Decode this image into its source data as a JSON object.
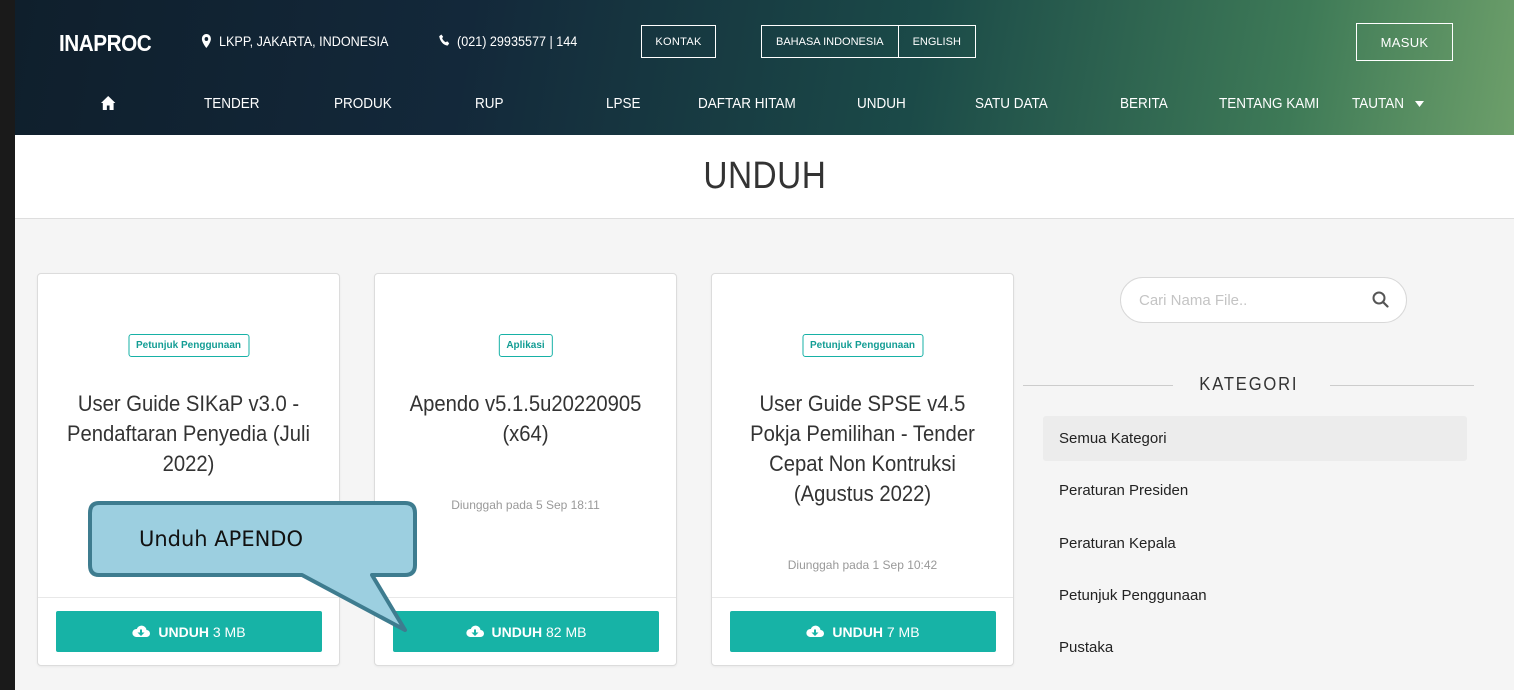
{
  "header": {
    "logo": "INAPROC",
    "location": "LKPP, JAKARTA, INDONESIA",
    "phone": "(021) 29935577 | 144",
    "contact_label": "KONTAK",
    "lang_id": "BAHASA INDONESIA",
    "lang_en": "ENGLISH",
    "login_label": "MASUK",
    "icons": {
      "location": "map-marker-icon",
      "phone": "phone-icon"
    }
  },
  "nav": {
    "home_icon": "home-icon",
    "items": [
      "TENDER",
      "PRODUK",
      "RUP",
      "LPSE",
      "DAFTAR HITAM",
      "UNDUH",
      "SATU DATA",
      "BERITA",
      "TENTANG KAMI",
      "TAUTAN"
    ]
  },
  "page_title": "UNDUH",
  "cards": [
    {
      "badge": "Petunjuk Penggunaan",
      "title": "User Guide SIKaP v3.0 - Pendaftaran Penyedia (Juli 2022)",
      "date": "",
      "button_action": "UNDUH",
      "button_size": "3 MB"
    },
    {
      "badge": "Aplikasi",
      "title": "Apendo v5.1.5u20220905 (x64)",
      "date": "Diunggah pada 5 Sep 18:11",
      "button_action": "UNDUH",
      "button_size": "82 MB"
    },
    {
      "badge": "Petunjuk Penggunaan",
      "title": "User Guide SPSE v4.5 Pokja Pemilihan - Tender Cepat Non Kontruksi (Agustus 2022)",
      "date": "Diunggah pada 1 Sep 10:42",
      "button_action": "UNDUH",
      "button_size": "7 MB"
    }
  ],
  "search": {
    "placeholder": "Cari Nama File.."
  },
  "sidebar": {
    "heading": "KATEGORI",
    "categories": [
      "Semua Kategori",
      "Peraturan Presiden",
      "Peraturan Kepala",
      "Petunjuk Penggunaan",
      "Pustaka"
    ],
    "active": "Semua Kategori"
  },
  "callout": {
    "text": "Unduh APENDO"
  },
  "colors": {
    "accent": "#17b3a6",
    "callout_fill": "#9ccfe0",
    "callout_border": "#3e7c8f"
  }
}
